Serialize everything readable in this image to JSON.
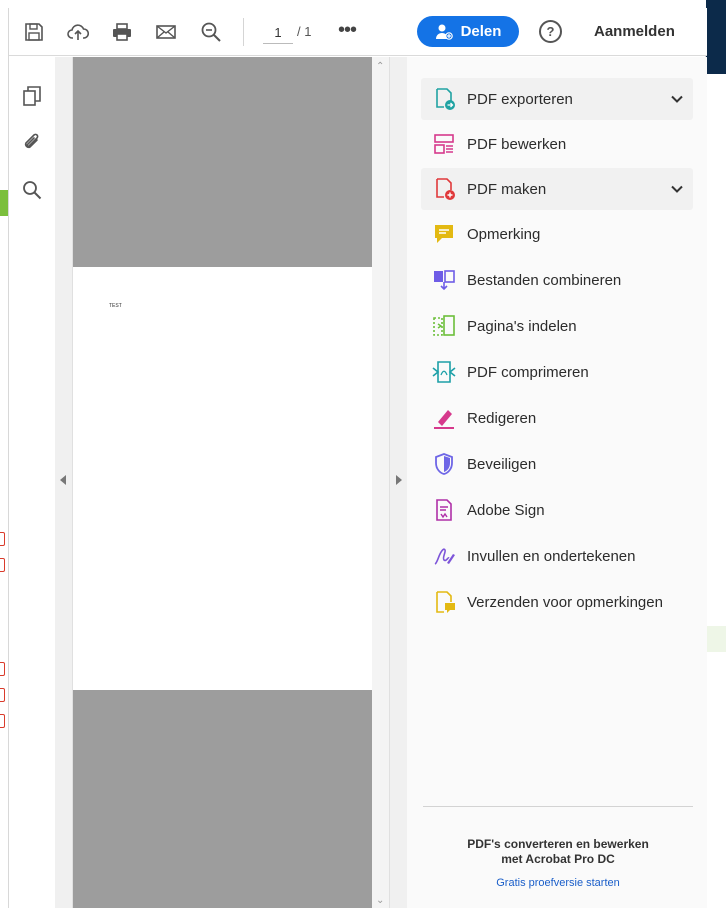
{
  "toolbar": {
    "icons": [
      "save-icon",
      "upload-cloud-icon",
      "print-icon",
      "mail-icon",
      "zoom-out-icon"
    ],
    "page_current": "1",
    "page_total": "/ 1",
    "more_label": "•••",
    "share_label": "Delen",
    "help_label": "?",
    "signin_label": "Aanmelden"
  },
  "rail": {
    "icons": [
      "pages-icon",
      "attachment-icon",
      "search-icon"
    ]
  },
  "document": {
    "page_text": "TEST"
  },
  "tools": [
    {
      "label": "PDF exporteren",
      "icon": "pdf-export-icon",
      "expandable": true,
      "color": "#20a3a3"
    },
    {
      "label": "PDF bewerken",
      "icon": "pdf-edit-icon",
      "expandable": false,
      "color": "#d6398c"
    },
    {
      "label": "PDF maken",
      "icon": "pdf-create-icon",
      "expandable": true,
      "color": "#e0393b"
    },
    {
      "label": "Opmerking",
      "icon": "comment-icon",
      "expandable": false,
      "color": "#e3b912"
    },
    {
      "label": "Bestanden combineren",
      "icon": "combine-files-icon",
      "expandable": false,
      "color": "#6e5ce6"
    },
    {
      "label": "Pagina's indelen",
      "icon": "organize-pages-icon",
      "expandable": false,
      "color": "#6cbf3a"
    },
    {
      "label": "PDF comprimeren",
      "icon": "compress-pdf-icon",
      "expandable": false,
      "color": "#1da0a8"
    },
    {
      "label": "Redigeren",
      "icon": "redact-icon",
      "expandable": false,
      "color": "#d6398c"
    },
    {
      "label": "Beveiligen",
      "icon": "protect-shield-icon",
      "expandable": false,
      "color": "#6e66e6"
    },
    {
      "label": "Adobe Sign",
      "icon": "adobe-sign-icon",
      "expandable": false,
      "color": "#b030a8"
    },
    {
      "label": "Invullen en ondertekenen",
      "icon": "fill-sign-icon",
      "expandable": false,
      "color": "#7d55d9"
    },
    {
      "label": "Verzenden voor opmerkingen",
      "icon": "send-for-comments-icon",
      "expandable": false,
      "color": "#e3b912"
    }
  ],
  "promo": {
    "line1": "PDF's converteren en bewerken",
    "line2": "met Acrobat Pro DC",
    "link": "Gratis proefversie starten"
  },
  "colors": {
    "accent": "#1473e6",
    "doc_gray": "#9d9d9d",
    "panel_bg": "#fafafa"
  }
}
